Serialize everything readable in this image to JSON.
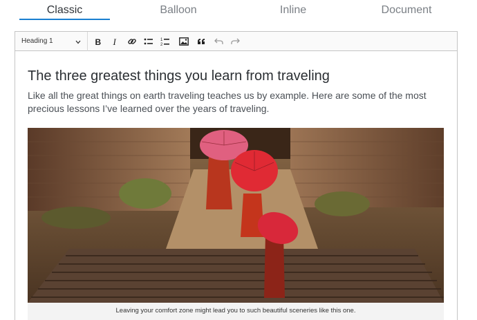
{
  "tabs": [
    {
      "label": "Classic",
      "active": true
    },
    {
      "label": "Balloon",
      "active": false
    },
    {
      "label": "Inline",
      "active": false
    },
    {
      "label": "Document",
      "active": false
    }
  ],
  "toolbar": {
    "heading_value": "Heading 1",
    "buttons": [
      "bold-icon",
      "italic-icon",
      "link-icon",
      "bulleted-list-icon",
      "numbered-list-icon",
      "image-icon",
      "blockquote-icon",
      "undo-icon",
      "redo-icon"
    ]
  },
  "content": {
    "title": "The three greatest things you learn from traveling",
    "intro": "Like all the great things on earth traveling teaches us by example. Here are some of the most precious lessons I’ve learned over the years of traveling.",
    "image_caption": "Leaving your comfort zone might lead you to such beautiful sceneries like this one."
  },
  "colors": {
    "accent": "#1a7fd0",
    "toolbar_bg": "#fafafa",
    "border": "#c4c4c4"
  }
}
